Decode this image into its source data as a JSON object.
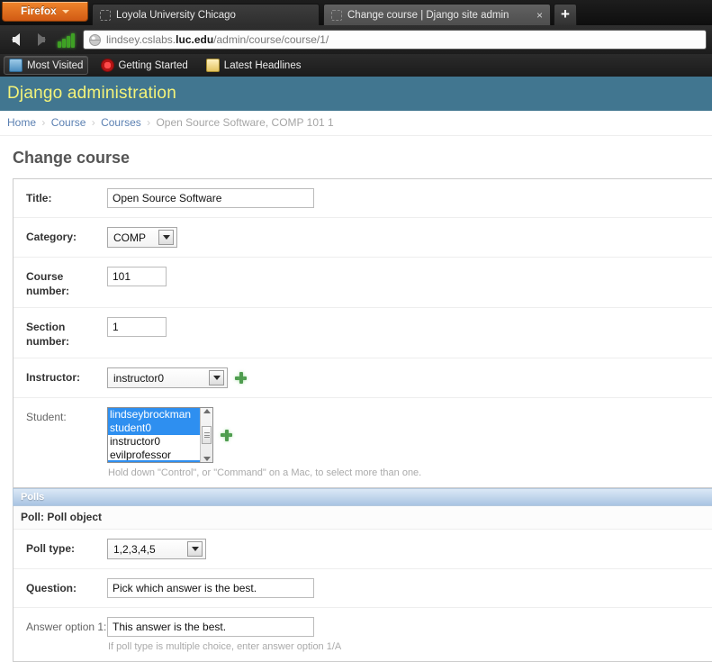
{
  "browser": {
    "firefox_menu_label": "Firefox",
    "tabs": [
      {
        "title": "Loyola University Chicago",
        "active": false,
        "favicon": "generic-page-icon"
      },
      {
        "title": "Change course | Django site admin",
        "active": true,
        "favicon": "generic-page-icon",
        "close_label": "×"
      }
    ],
    "new_tab_label": "+",
    "nav": {
      "back_label": "Back",
      "forward_label": "Forward",
      "status_icon": "signal-bars-icon"
    },
    "url": {
      "prefix": "lindsey.cslabs.",
      "domain": "luc.edu",
      "path": "/admin/course/course/1/",
      "security_icon": "globe-icon"
    },
    "bookmarks": [
      {
        "label": "Most Visited",
        "icon": "most-visited-icon",
        "pressed": true
      },
      {
        "label": "Getting Started",
        "icon": "getting-started-icon",
        "pressed": false
      },
      {
        "label": "Latest Headlines",
        "icon": "rss-feed-icon",
        "pressed": false
      }
    ]
  },
  "django": {
    "site_title": "Django administration",
    "header_bg": "#417690",
    "header_fg": "#f4f379",
    "breadcrumbs": [
      {
        "label": "Home",
        "current": false
      },
      {
        "label": "Course",
        "current": false
      },
      {
        "label": "Courses",
        "current": false
      },
      {
        "label": "Open Source Software, COMP 101 1",
        "current": true
      }
    ],
    "breadcrumb_separator": "›",
    "page_title": "Change course"
  },
  "form": {
    "fields": [
      {
        "name": "title",
        "label": "Title:",
        "type": "text",
        "value": "Open Source Software",
        "required": true
      },
      {
        "name": "category",
        "label": "Category:",
        "type": "select",
        "value": "COMP",
        "required": true
      },
      {
        "name": "course-number",
        "label": "Course number:",
        "type": "text",
        "value": "101",
        "required": true
      },
      {
        "name": "section-number",
        "label": "Section number:",
        "type": "text",
        "value": "1",
        "required": true
      },
      {
        "name": "instructor",
        "label": "Instructor:",
        "type": "select",
        "value": "instructor0",
        "required": true,
        "add_another": true
      },
      {
        "name": "student",
        "label": "Student:",
        "type": "multiselect",
        "required": false,
        "add_another": true,
        "options": [
          {
            "label": "lindseybrockman",
            "selected": true
          },
          {
            "label": "student0",
            "selected": true
          },
          {
            "label": "instructor0",
            "selected": false
          },
          {
            "label": "evilprofessor",
            "selected": false
          }
        ],
        "help_text": "Hold down \"Control\", or \"Command\" on a Mac, to select more than one."
      }
    ]
  },
  "inline": {
    "group_title": "Polls",
    "object_title": "Poll: Poll object",
    "fields": [
      {
        "name": "poll-type",
        "label": "Poll type:",
        "type": "select",
        "value": "1,2,3,4,5",
        "required": true
      },
      {
        "name": "question",
        "label": "Question:",
        "type": "text",
        "value": "Pick which answer is the best.",
        "required": true
      },
      {
        "name": "answer-option-1",
        "label": "Answer option 1:",
        "type": "text",
        "value": "This answer is the best.",
        "required": false,
        "help_text": "If poll type is multiple choice, enter answer option 1/A"
      }
    ]
  }
}
